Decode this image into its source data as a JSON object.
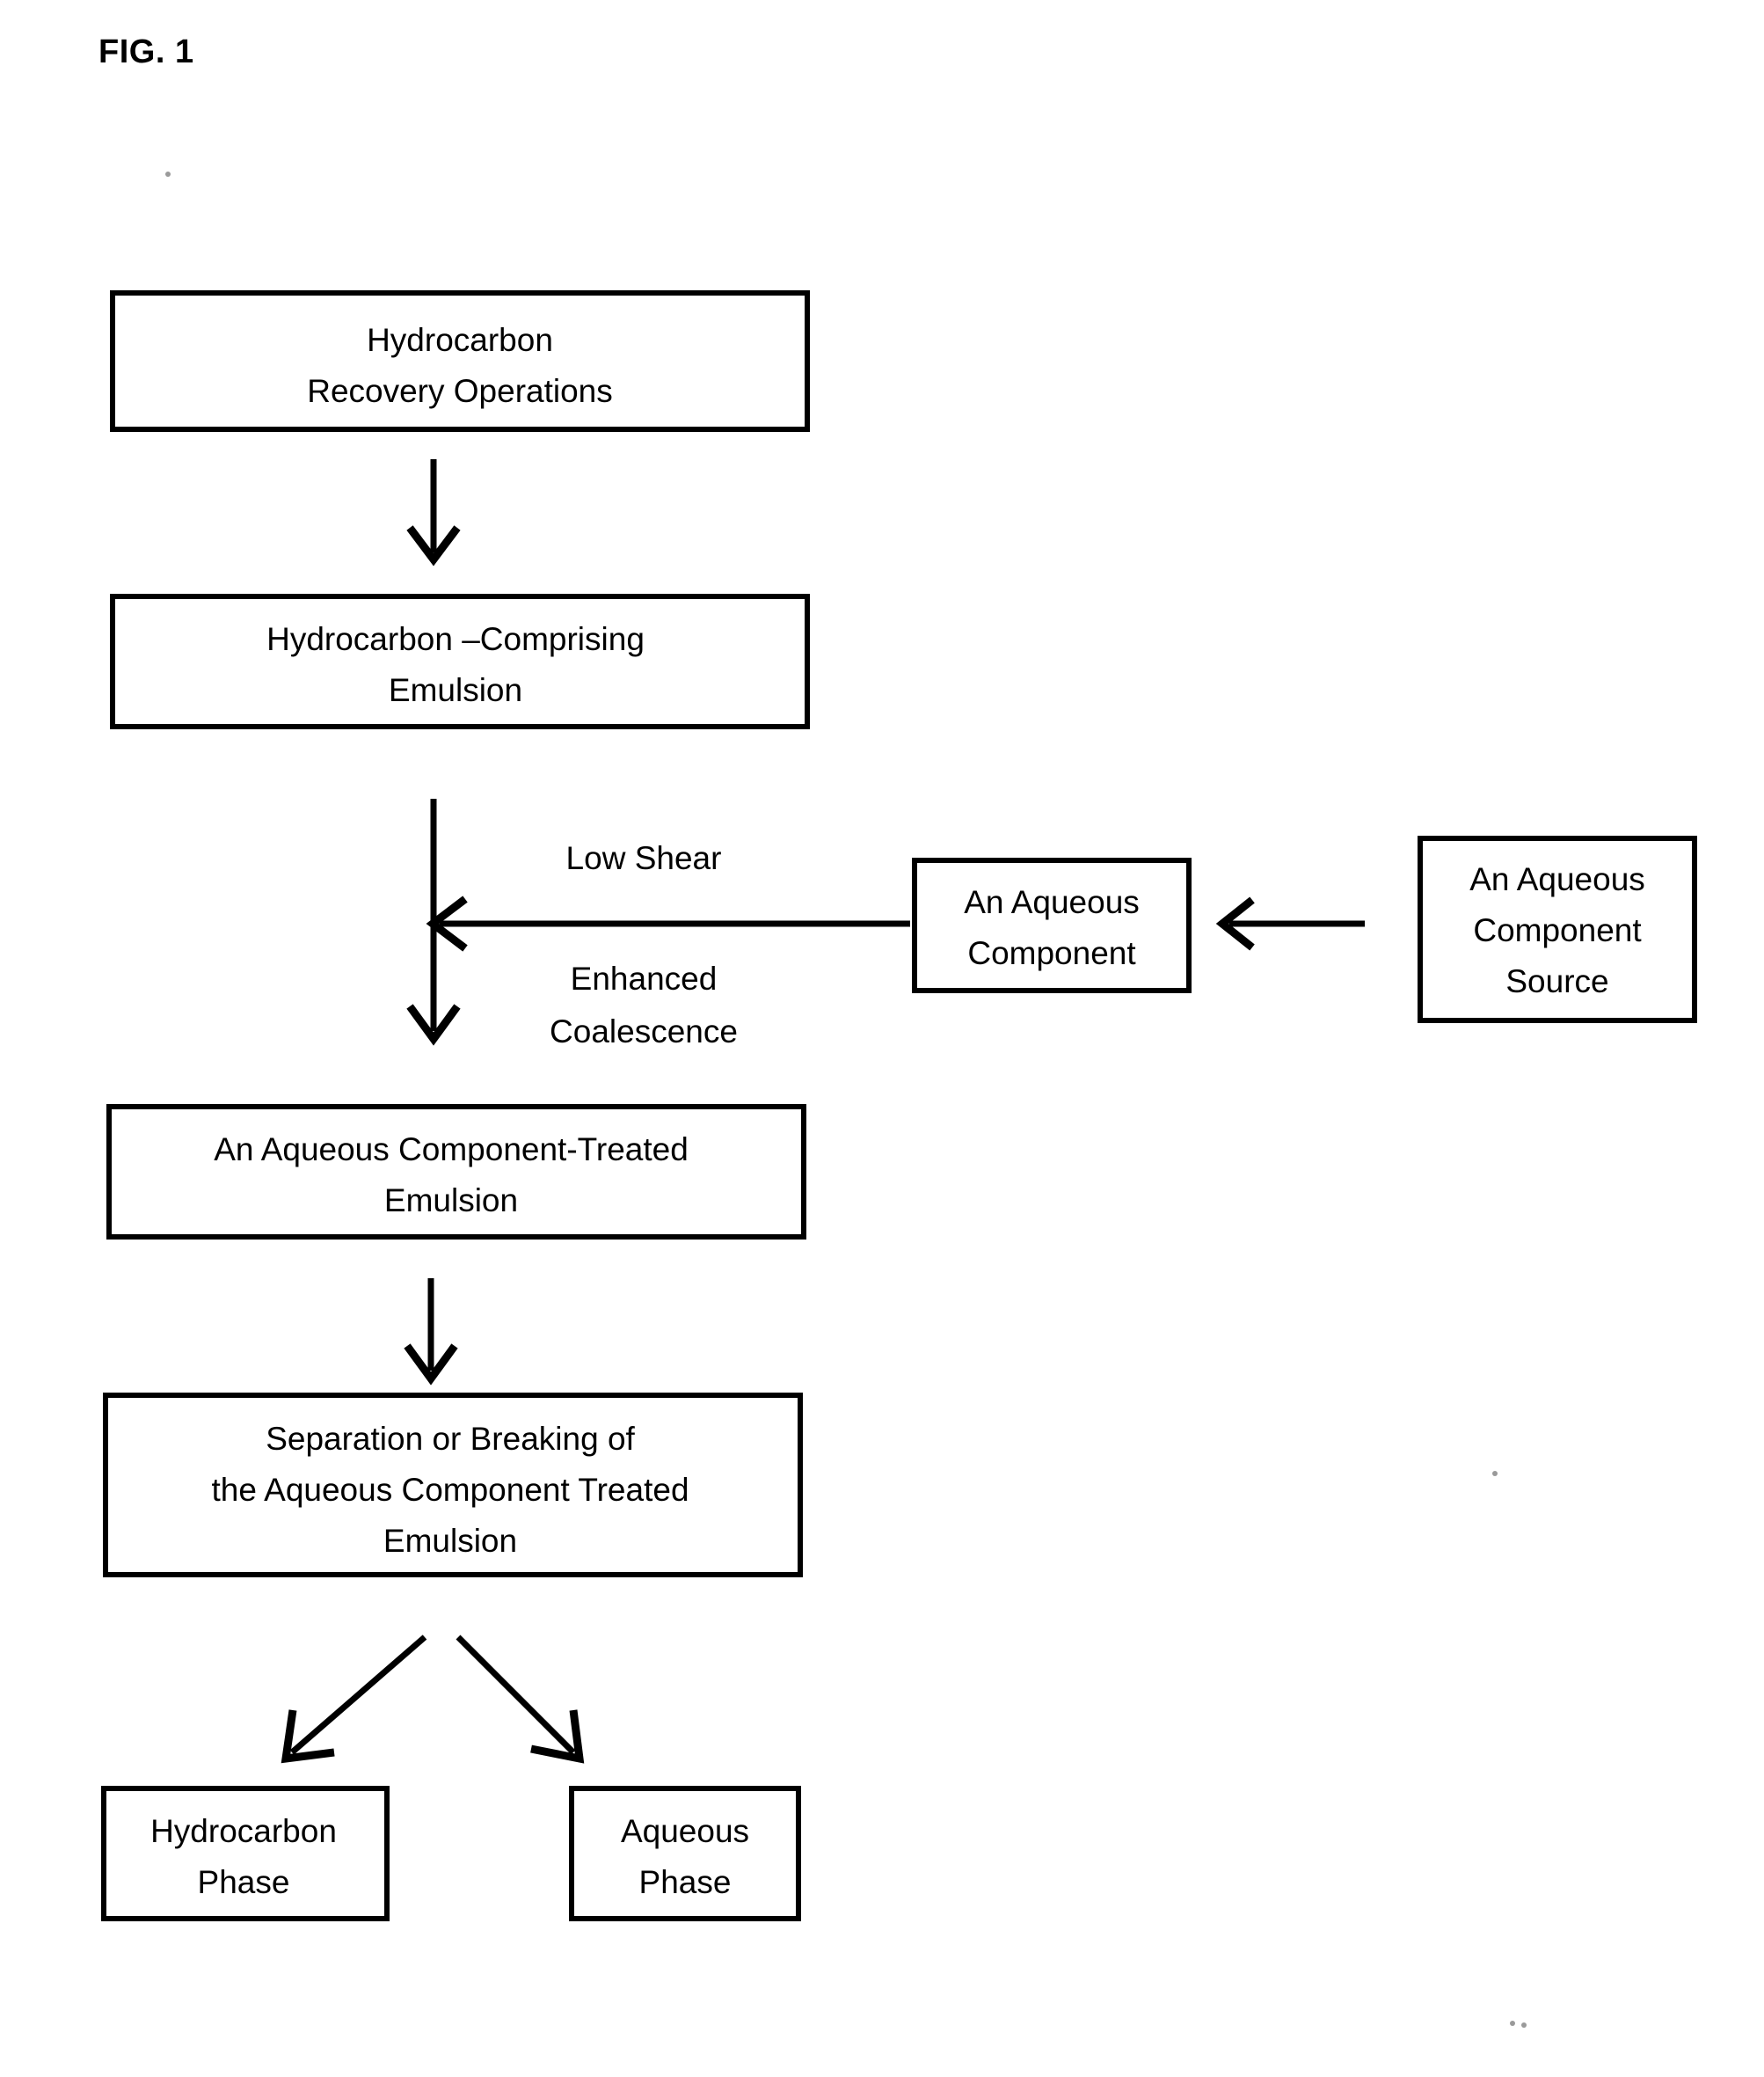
{
  "figure": {
    "title": "FIG. 1",
    "background_color": "#ffffff",
    "line_color": "#000000"
  },
  "nodes": {
    "hydrocarbon_recovery": {
      "line1": "Hydrocarbon",
      "line2": "Recovery Operations"
    },
    "hydrocarbon_emulsion": {
      "line1": "Hydrocarbon –Comprising",
      "line2": "Emulsion"
    },
    "aqueous_component": {
      "line1": "An Aqueous",
      "line2": "Component"
    },
    "aqueous_component_source": {
      "line1": "An Aqueous",
      "line2": "Component",
      "line3": "Source"
    },
    "treated_emulsion": {
      "line1": "An Aqueous Component-Treated",
      "line2": "Emulsion"
    },
    "separation_breaking": {
      "line1": "Separation or Breaking of",
      "line2": "the Aqueous Component Treated",
      "line3": "Emulsion"
    },
    "hydrocarbon_phase": {
      "line1": "Hydrocarbon",
      "line2": "Phase"
    },
    "aqueous_phase": {
      "line1": "Aqueous",
      "line2": "Phase"
    }
  },
  "edge_labels": {
    "low_shear": "Low Shear",
    "enhanced": "Enhanced",
    "coalescence": "Coalescence"
  },
  "chart_data": {
    "type": "table",
    "title": "FIG. 1",
    "diagram_kind": "process-flowchart",
    "nodes": [
      {
        "id": "hydrocarbon_recovery",
        "label": "Hydrocarbon Recovery Operations"
      },
      {
        "id": "hydrocarbon_emulsion",
        "label": "Hydrocarbon –Comprising Emulsion"
      },
      {
        "id": "aqueous_component",
        "label": "An Aqueous Component"
      },
      {
        "id": "aqueous_component_source",
        "label": "An Aqueous Component Source"
      },
      {
        "id": "treated_emulsion",
        "label": "An Aqueous Component-Treated Emulsion"
      },
      {
        "id": "separation_breaking",
        "label": "Separation or Breaking of the Aqueous Component Treated Emulsion"
      },
      {
        "id": "hydrocarbon_phase",
        "label": "Hydrocarbon Phase"
      },
      {
        "id": "aqueous_phase",
        "label": "Aqueous Phase"
      }
    ],
    "edges": [
      {
        "from": "hydrocarbon_recovery",
        "to": "hydrocarbon_emulsion",
        "label": ""
      },
      {
        "from": "hydrocarbon_emulsion",
        "to": "treated_emulsion",
        "label": "Low Shear / Enhanced Coalescence"
      },
      {
        "from": "aqueous_component",
        "to": "hydrocarbon_emulsion",
        "label": ""
      },
      {
        "from": "aqueous_component_source",
        "to": "aqueous_component",
        "label": ""
      },
      {
        "from": "treated_emulsion",
        "to": "separation_breaking",
        "label": ""
      },
      {
        "from": "separation_breaking",
        "to": "hydrocarbon_phase",
        "label": ""
      },
      {
        "from": "separation_breaking",
        "to": "aqueous_phase",
        "label": ""
      }
    ]
  }
}
